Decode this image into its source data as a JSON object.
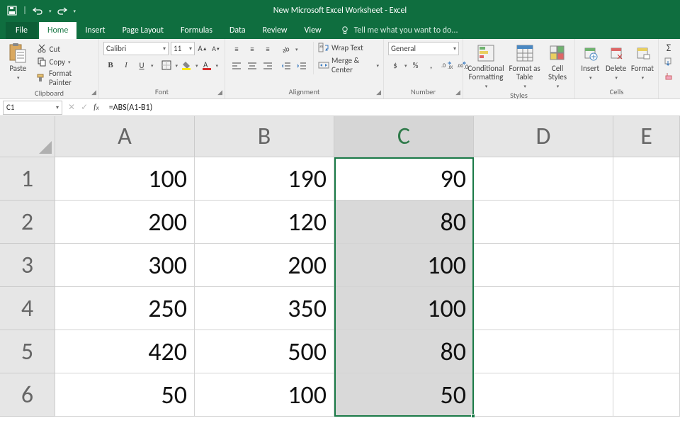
{
  "title": "New Microsoft Excel Worksheet - Excel",
  "tabs": {
    "file": "File",
    "home": "Home",
    "insert": "Insert",
    "page_layout": "Page Layout",
    "formulas": "Formulas",
    "data": "Data",
    "review": "Review",
    "view": "View"
  },
  "tellme": "Tell me what you want to do...",
  "ribbon": {
    "clipboard": {
      "paste": "Paste",
      "cut": "Cut",
      "copy": "Copy",
      "format_painter": "Format Painter",
      "label": "Clipboard"
    },
    "font": {
      "name": "Calibri",
      "size": "11",
      "label": "Font"
    },
    "alignment": {
      "wrap": "Wrap Text",
      "merge": "Merge & Center",
      "label": "Alignment"
    },
    "number": {
      "format": "General",
      "label": "Number"
    },
    "styles": {
      "conditional": "Conditional\nFormatting",
      "table": "Format as\nTable",
      "cell": "Cell\nStyles",
      "label": "Styles"
    },
    "cells": {
      "insert": "Insert",
      "delete": "Delete",
      "format": "Format",
      "label": "Cells"
    }
  },
  "formula_bar": {
    "name_box": "C1",
    "formula": "=ABS(A1-B1)"
  },
  "columns": [
    "A",
    "B",
    "C",
    "D",
    "E"
  ],
  "rows": [
    "1",
    "2",
    "3",
    "4",
    "5",
    "6"
  ],
  "selected_col_index": 2,
  "cells": [
    [
      "100",
      "190",
      "90",
      "",
      ""
    ],
    [
      "200",
      "120",
      "80",
      "",
      ""
    ],
    [
      "300",
      "200",
      "100",
      "",
      ""
    ],
    [
      "250",
      "350",
      "100",
      "",
      ""
    ],
    [
      "420",
      "500",
      "80",
      "",
      ""
    ],
    [
      "50",
      "100",
      "50",
      "",
      ""
    ]
  ],
  "colors": {
    "brand": "#0f6e3f",
    "select": "#1a7a47"
  }
}
